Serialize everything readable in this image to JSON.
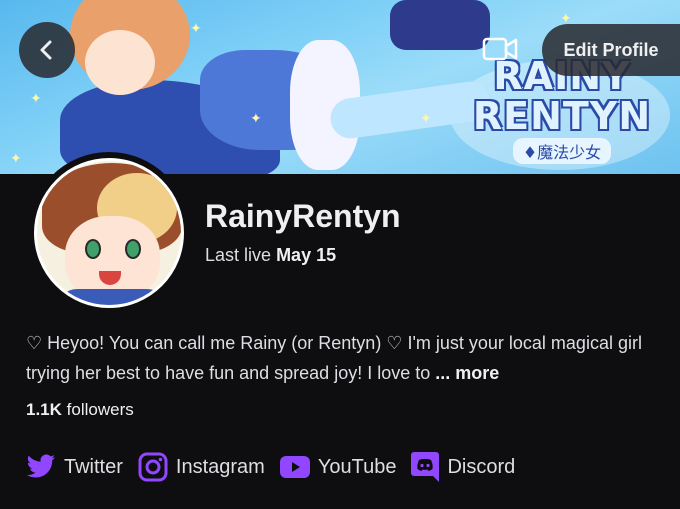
{
  "banner": {
    "logo_line1": "RAINY",
    "logo_line2": "RENTYN",
    "logo_subtitle": "♦魔法少女"
  },
  "header": {
    "back_icon": "chevron-left-icon",
    "video_icon": "video-camera-icon",
    "edit_profile_label": "Edit Profile"
  },
  "profile": {
    "display_name": "RainyRentyn",
    "last_live_prefix": "Last live",
    "last_live_date": "May 15",
    "bio_text": "♡ Heyoo! You can call me Rainy (or Rentyn) ♡  I'm just your local magical girl trying her best to have fun and spread joy! I love to",
    "bio_more": "... more",
    "followers_count": "1.1K",
    "followers_label": "followers"
  },
  "socials": [
    {
      "label": "Twitter",
      "icon": "twitter-icon"
    },
    {
      "label": "Instagram",
      "icon": "instagram-icon"
    },
    {
      "label": "YouTube",
      "icon": "youtube-icon"
    },
    {
      "label": "Discord",
      "icon": "discord-icon"
    }
  ],
  "colors": {
    "background": "#0e0e10",
    "accent": "#9147ff",
    "text": "#efeff1"
  }
}
